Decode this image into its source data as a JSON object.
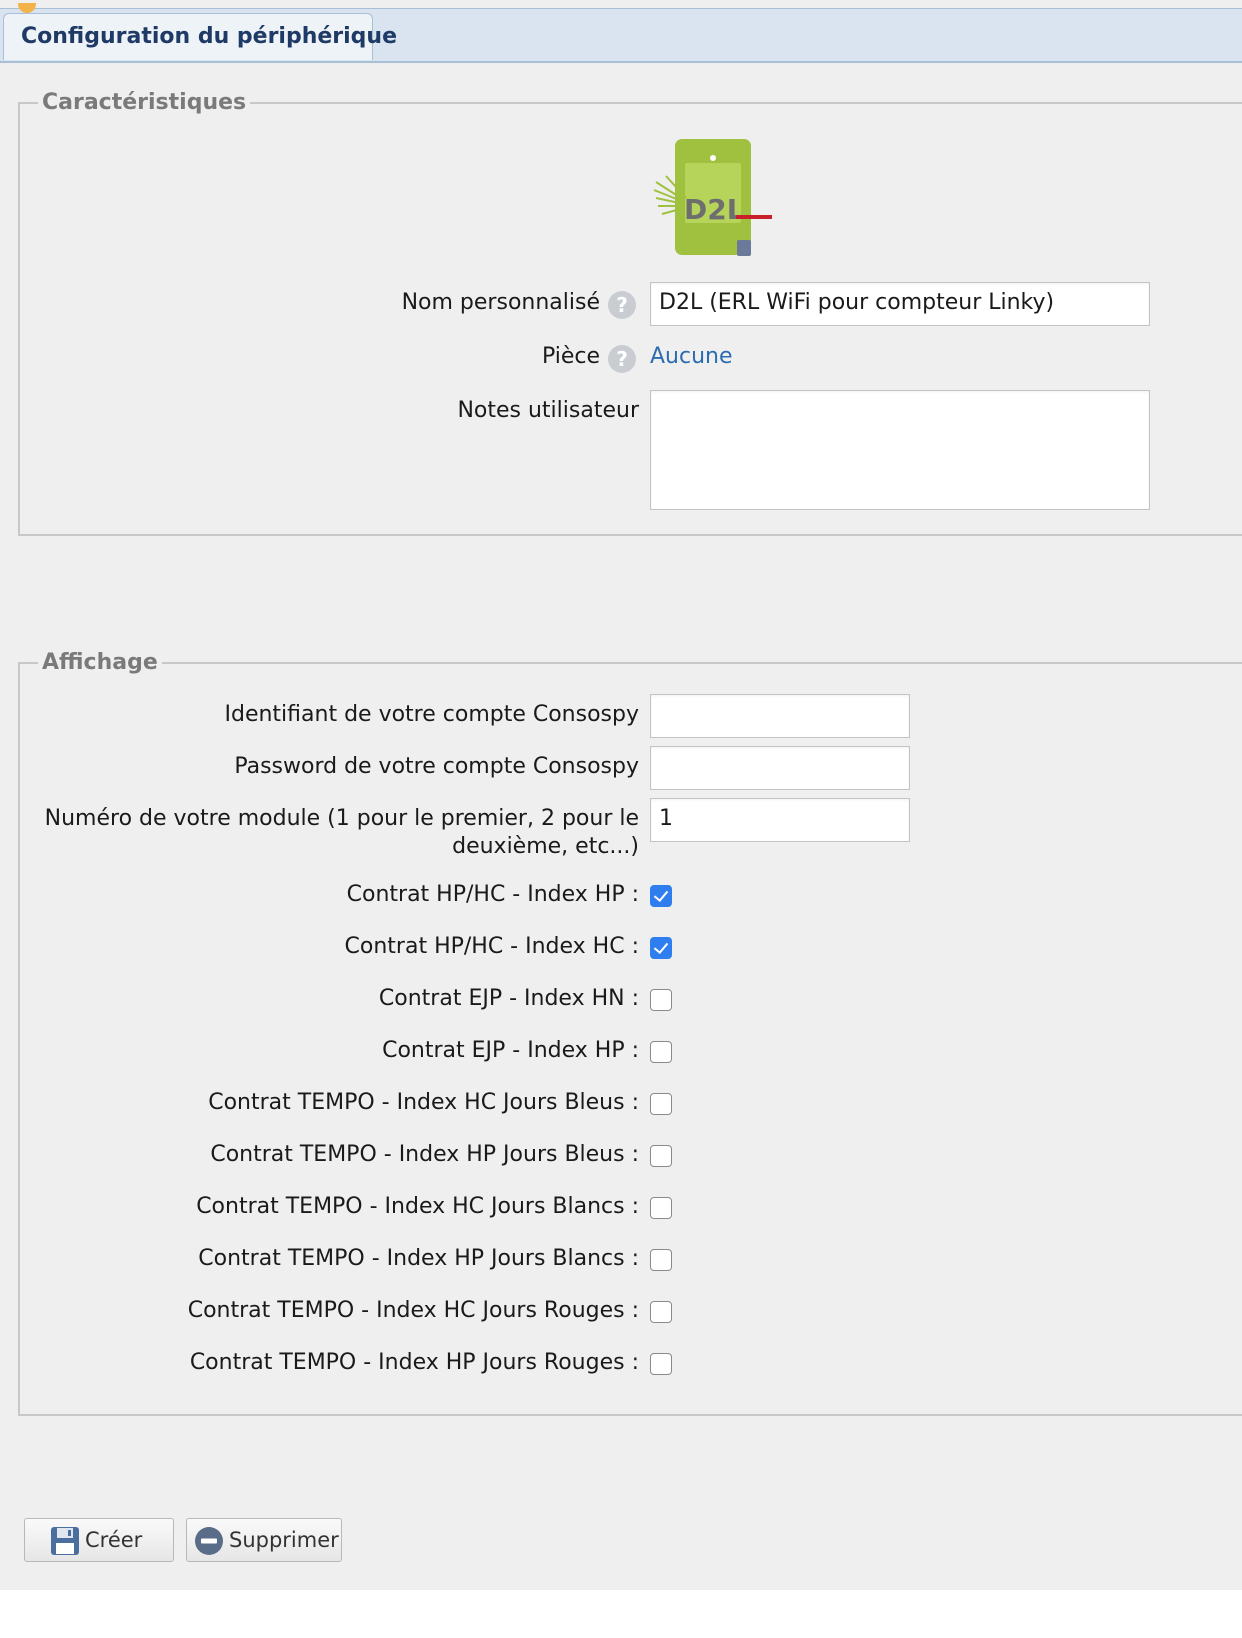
{
  "tab": {
    "label": "Configuration du périphérique"
  },
  "characteristics": {
    "legend": "Caractéristiques",
    "device_logo_text": "D2L",
    "custom_name": {
      "label": "Nom personnalisé",
      "value": "D2L (ERL WiFi pour compteur Linky)"
    },
    "room": {
      "label": "Pièce",
      "value": "Aucune"
    },
    "notes": {
      "label": "Notes utilisateur",
      "value": ""
    },
    "help_glyph": "?"
  },
  "display": {
    "legend": "Affichage",
    "consospy_id": {
      "label": "Identifiant de votre compte Consospy",
      "value": ""
    },
    "consospy_password": {
      "label": "Password de votre compte Consospy",
      "value": ""
    },
    "module_number": {
      "label_line1": "Numéro de votre module (1 pour le premier, 2 pour le",
      "label_line2": "deuxième, etc...)",
      "value": "1"
    },
    "contracts": [
      {
        "label": "Contrat HP/HC - Index HP :",
        "checked": true
      },
      {
        "label": "Contrat HP/HC - Index HC :",
        "checked": true
      },
      {
        "label": "Contrat EJP - Index HN :",
        "checked": false
      },
      {
        "label": "Contrat EJP - Index HP :",
        "checked": false
      },
      {
        "label": "Contrat TEMPO - Index HC Jours Bleus :",
        "checked": false
      },
      {
        "label": "Contrat TEMPO - Index HP Jours Bleus :",
        "checked": false
      },
      {
        "label": "Contrat TEMPO - Index HC Jours Blancs :",
        "checked": false
      },
      {
        "label": "Contrat TEMPO - Index HP Jours Blancs :",
        "checked": false
      },
      {
        "label": "Contrat TEMPO - Index HC Jours Rouges :",
        "checked": false
      },
      {
        "label": "Contrat TEMPO - Index HP Jours Rouges :",
        "checked": false
      }
    ]
  },
  "actions": {
    "create_label": "Créer",
    "delete_label": "Supprimer"
  },
  "colors": {
    "accent": "#2f7ef0",
    "link": "#2c6cb0",
    "tab_text": "#1f3a66",
    "logo_green": "#9fc13f",
    "logo_red": "#c8202a"
  },
  "icons": {
    "help": "question-circle-icon",
    "save": "floppy-disk-icon",
    "delete": "minus-circle-icon"
  }
}
